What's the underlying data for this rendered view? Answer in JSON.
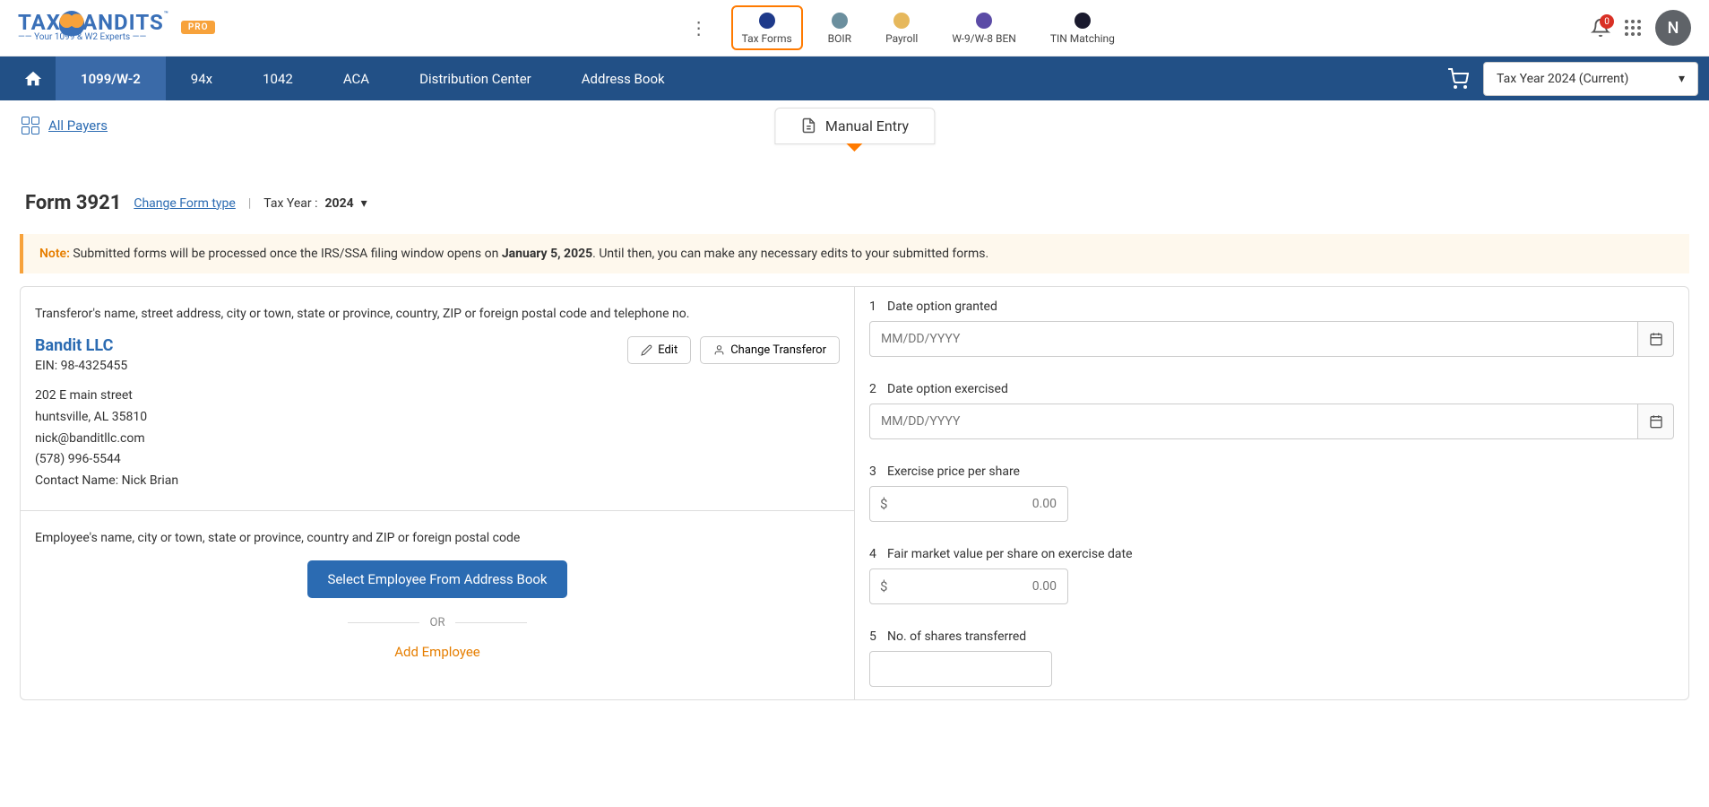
{
  "logo": {
    "text_a": "TAX",
    "text_b": "ANDITS",
    "tm": "™",
    "pro": "PRO",
    "tagline": "Your 1099 & W2 Experts"
  },
  "top_nav": {
    "tax_forms": "Tax Forms",
    "boir": "BOIR",
    "payroll": "Payroll",
    "w9": "W-9/W-8 BEN",
    "tin": "TIN Matching"
  },
  "notifications": {
    "count": "0"
  },
  "avatar": "N",
  "main_nav": {
    "tab_1099": "1099/W-2",
    "tab_94x": "94x",
    "tab_1042": "1042",
    "tab_aca": "ACA",
    "tab_dist": "Distribution Center",
    "tab_addr": "Address Book"
  },
  "year_dropdown": "Tax Year 2024 (Current)",
  "all_payers": "All Payers",
  "manual_entry": "Manual Entry",
  "form_header": {
    "title": "Form 3921",
    "change": "Change Form type",
    "tax_year_label": "Tax Year :",
    "tax_year_value": "2024"
  },
  "note": {
    "label": "Note:",
    "pre": " Submitted forms will be processed once the IRS/SSA filing window opens on ",
    "date": "January 5, 2025",
    "post": ". Until then, you can make any necessary edits to your submitted forms."
  },
  "transferor": {
    "label": "Transferor's name, street address, city or town, state or province, country, ZIP or foreign postal code and telephone no.",
    "company": "Bandit LLC",
    "ein": "EIN: 98-4325455",
    "street": "202 E main street",
    "csz": "huntsville, AL 35810",
    "email": "nick@banditllc.com",
    "phone": "(578) 996-5544",
    "contact": "Contact Name: Nick Brian",
    "edit": "Edit",
    "change": "Change Transferor"
  },
  "employee": {
    "label": "Employee's name, city or town, state or province, country and ZIP or foreign postal code",
    "select_btn": "Select Employee From Address Book",
    "or": "OR",
    "add": "Add Employee"
  },
  "fields": {
    "f1": {
      "num": "1",
      "label": "Date option granted",
      "placeholder": "MM/DD/YYYY"
    },
    "f2": {
      "num": "2",
      "label": "Date option exercised",
      "placeholder": "MM/DD/YYYY"
    },
    "f3": {
      "num": "3",
      "label": "Exercise price per share",
      "placeholder": "0.00"
    },
    "f4": {
      "num": "4",
      "label": "Fair market value per share on exercise date",
      "placeholder": "0.00"
    },
    "f5": {
      "num": "5",
      "label": "No. of shares transferred"
    }
  }
}
